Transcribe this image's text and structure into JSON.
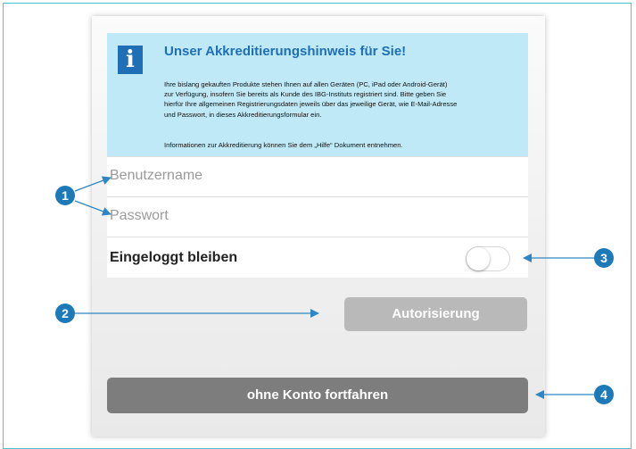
{
  "info": {
    "icon": "info-icon",
    "title": "Unser Akkreditierungshinweis für Sie!",
    "body_lines": [
      "Ihre bislang gekauften Produkte stehen Ihnen auf allen Geräten (PC, iPad oder Android-Gerät)",
      "zur Verfügung, insofern Sie bereits als Kunde des IBG-Instituts registriert sind. Bitte geben Sie",
      "hierfür Ihre allgemeinen Registrierungsdaten jeweils über das jeweilige Gerät, wie E-Mail-Adresse",
      "und Passwort, in dieses Akkreditierungsformular ein."
    ],
    "note": "Informationen zur Akkreditierung können Sie dem „Hilfe“ Dokument entnehmen."
  },
  "form": {
    "username_placeholder": "Benutzername",
    "password_placeholder": "Passwort",
    "stay_logged_in": "Eingeloggt bleiben"
  },
  "buttons": {
    "authorize": "Autorisierung",
    "continue_without_account": "ohne Konto fortfahren"
  },
  "markers": [
    "1",
    "2",
    "3",
    "4"
  ],
  "colors": {
    "marker": "#1d7ab8",
    "arrow": "#2f86c4",
    "info_bg": "#bfe9f6",
    "info_title": "#1e6fb5",
    "authorize_btn": "#b9b9b9",
    "continue_btn": "#7d7d7d",
    "frame": "#4cc3cf"
  }
}
